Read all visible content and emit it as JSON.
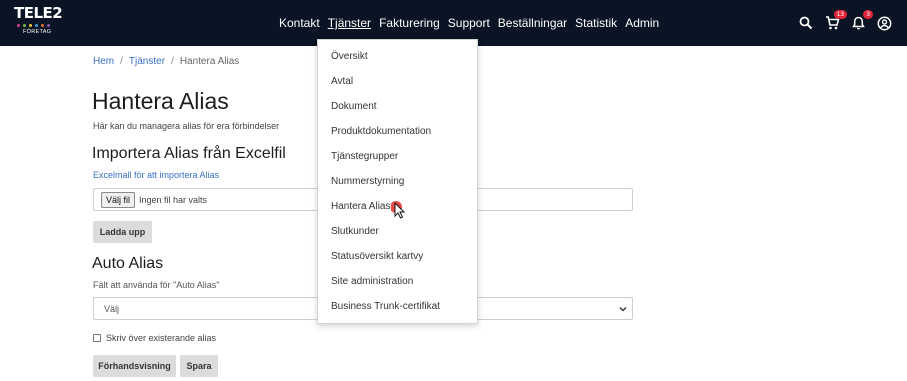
{
  "logo": {
    "word": "TELE2",
    "sub": "FÖRETAG",
    "dot_colors": [
      "#d13c8c",
      "#7bb547",
      "#f0c22b",
      "#3aa0d8",
      "#e26b2c",
      "#8b59b4"
    ]
  },
  "nav": {
    "items": [
      "Kontakt",
      "Tjänster",
      "Fakturering",
      "Support",
      "Beställningar",
      "Statistik",
      "Admin"
    ],
    "active": "Tjänster"
  },
  "header_icons": {
    "search": "search-icon",
    "cart": "cart-icon",
    "cart_count": "13",
    "bell": "bell-icon",
    "bell_count": "3",
    "account": "account-icon"
  },
  "breadcrumb": {
    "home": "Hem",
    "services": "Tjänster",
    "current": "Hantera Alias",
    "separator": "/"
  },
  "page": {
    "title": "Hantera Alias",
    "description": "Här kan du managera alias för era förbindelser"
  },
  "import": {
    "heading": "Importera Alias från Excelfil",
    "template_link": "Excelmall för att importera Alias",
    "file_button": "Välj fil",
    "file_status": "Ingen fil har valts",
    "upload_button": "Ladda upp"
  },
  "auto_alias": {
    "heading": "Auto Alias",
    "field_label": "Fält att använda för \"Auto Alias\"",
    "select_value": "Välj",
    "overwrite_label": "Skriv över existerande alias",
    "preview_button": "Förhandsvisning",
    "save_button": "Spara"
  },
  "dropdown": {
    "items": [
      "Översikt",
      "Avtal",
      "Dokument",
      "Produktdokumentation",
      "Tjänstegrupper",
      "Nummerstyrning",
      "Hantera Alias",
      "Slutkunder",
      "Statusöversikt kartvy",
      "Site administration",
      "Business Trunk-certifikat"
    ]
  },
  "colors": {
    "header_bg": "#0a1424",
    "link": "#3a6fc4",
    "badge": "#e0263a",
    "button_bg": "#dcdcdc"
  }
}
